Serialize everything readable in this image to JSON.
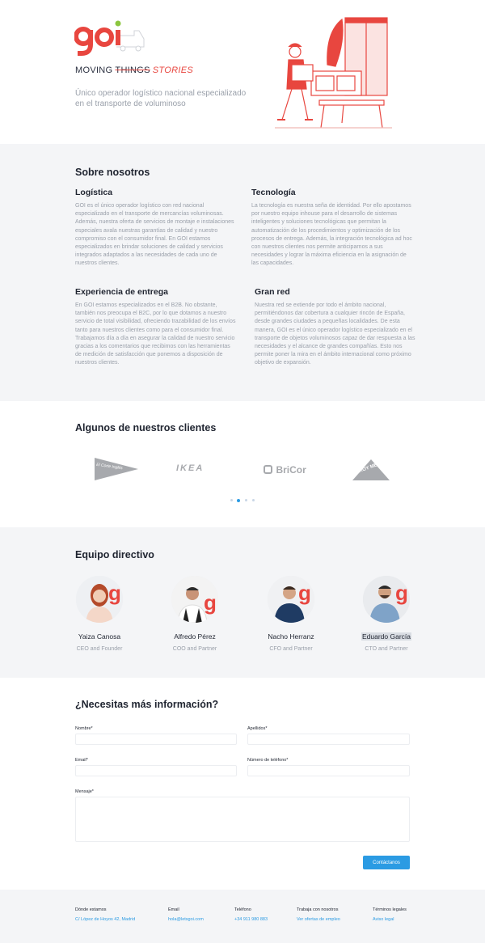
{
  "hero": {
    "logo_text": "goi",
    "tagline_moving": "MOVING",
    "tagline_things": "THINGS",
    "tagline_stories": "STORIES",
    "description": "Único operador logístico nacional especializado en el transporte de voluminoso"
  },
  "about": {
    "title": "Sobre nosotros",
    "cards": [
      {
        "title": "Logística",
        "text": "GOI es el único operador logístico con red nacional especializado en el transporte de mercancías voluminosas. Además, nuestra oferta de servicios de montaje e instalaciones especiales avala nuestras garantías de calidad y nuestro compromiso con el consumidor final. En GOI estamos especializados en brindar soluciones de calidad y servicios integrados adaptados a las necesidades de cada uno de nuestros clientes."
      },
      {
        "title": "Tecnología",
        "text": "La tecnología es nuestra seña de identidad. Por ello apostamos por nuestro equipo inhouse para el desarrollo de sistemas inteligentes y soluciones tecnológicas que permitan la automatización de los procedimientos y optimización de los procesos de entrega. Además, la integración tecnológica ad hoc con nuestros clientes nos permite anticiparnos a sus necesidades y lograr la máxima eficiencia en la asignación de las capacidades."
      },
      {
        "title": "Experiencia de entrega",
        "text": "En GOI estamos especializados en el B2B. No obstante, también nos preocupa el B2C, por lo que dotamos a nuestro servicio de total visibilidad, ofreciendo trazabilidad de los envíos tanto para nuestros clientes como para el consumidor final. Trabajamos día a día en asegurar la calidad de nuestro servicio gracias a los comentarios que recibimos con las herramientas de medición de satisfacción que ponemos a disposición de nuestros clientes."
      },
      {
        "title": "Gran red",
        "text": "Nuestra red se extiende por todo el ámbito nacional, permitiéndonos dar cobertura a cualquier rincón de España, desde grandes ciudades a pequeñas localidades. De esta manera, GOI es el único operador logístico especializado en el transporte de objetos voluminosos capaz de dar respuesta a las necesidades y el alcance de grandes compañías. Esto nos permite poner la mira en el ámbito internacional como próximo objetivo de expansión."
      }
    ]
  },
  "clients": {
    "title": "Algunos de nuestros clientes",
    "logos": [
      "El Corte Inglés",
      "IKEA",
      "BriCor",
      "LEROY MERLIN"
    ],
    "carousel_pages": 4,
    "carousel_active": 2
  },
  "team": {
    "title": "Equipo directivo",
    "members": [
      {
        "name": "Yaiza Canosa",
        "role": "CEO and Founder"
      },
      {
        "name": "Alfredo Pérez",
        "role": "COO and Partner"
      },
      {
        "name": "Nacho Herranz",
        "role": "CFO and Partner"
      },
      {
        "name": "Eduardo García",
        "role": "CTO and Partner"
      }
    ]
  },
  "contact": {
    "title": "¿Necesitas más información?",
    "fields": {
      "nombre": {
        "label": "Nombre*",
        "value": ""
      },
      "apellidos": {
        "label": "Apellidos*",
        "value": ""
      },
      "email": {
        "label": "Email*",
        "value": ""
      },
      "telefono": {
        "label": "Número de teléfono*",
        "value": ""
      },
      "mensaje": {
        "label": "Mensaje*",
        "value": ""
      }
    },
    "submit_label": "Contáctanos"
  },
  "footer": {
    "columns": [
      {
        "heading": "Dónde estamos",
        "link": "C/ López de Hoyos 42, Madrid"
      },
      {
        "heading": "Email",
        "link": "hola@letsgoi.com"
      },
      {
        "heading": "Teléfono",
        "link": "+34 911 980 883"
      },
      {
        "heading": "Trabaja con nosotros",
        "link": "Ver ofertas de empleo"
      },
      {
        "heading": "Términos legales",
        "link": "Aviso legal"
      }
    ]
  },
  "colors": {
    "brand_red": "#e8463f",
    "brand_green": "#8cc63f",
    "accent_blue": "#2b9be3"
  }
}
